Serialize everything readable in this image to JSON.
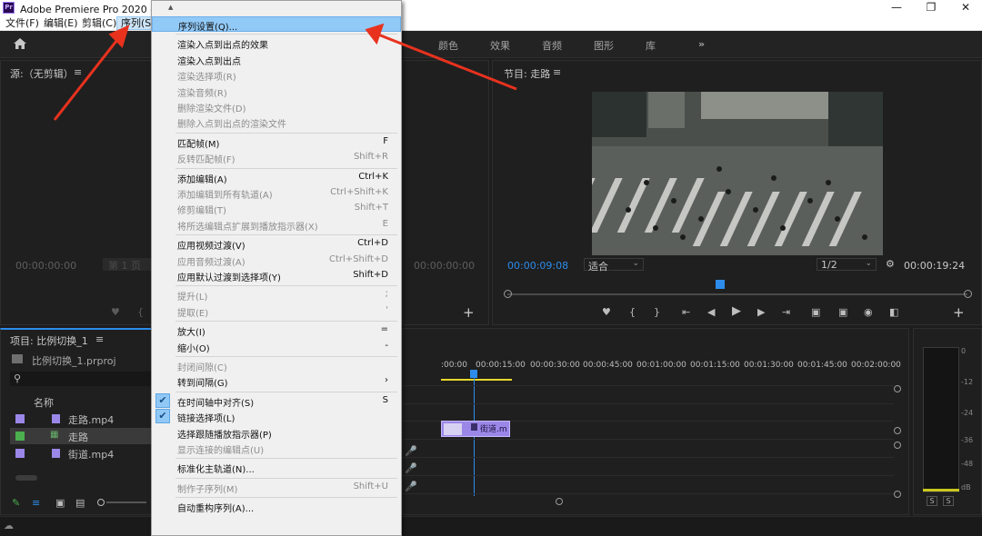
{
  "window": {
    "title": "Adobe Premiere Pro 2020 - E:\\用",
    "logo": "Pr",
    "min_icon": "minimize-icon",
    "max_icon": "restore-icon",
    "close_icon": "close-icon"
  },
  "menubar": [
    "文件(F)",
    "编辑(E)",
    "剪辑(C)",
    "序列(S)"
  ],
  "workspaces": [
    "颜色",
    "效果",
    "音频",
    "图形",
    "库"
  ],
  "workspaces_more": "»",
  "source_panel": {
    "title": "源:（无剪辑）",
    "timecode": "00:00:00:00",
    "page": "第 1 页",
    "timecode_right": "00:00:00:00",
    "add": "+"
  },
  "program_panel": {
    "title": "节目: 走路",
    "timecode": "00:00:09:08",
    "fit": "适合",
    "resolution": "1/2",
    "duration": "00:00:19:24",
    "add": "+"
  },
  "project_panel": {
    "title": "项目: 比例切换_1",
    "filename": "比例切换_1.prproj",
    "column_name": "名称",
    "items": [
      {
        "name": "走路.mp4",
        "color": "#9b87e8"
      },
      {
        "name": "走路",
        "color": "#4caf50"
      },
      {
        "name": "街道.mp4",
        "color": "#9b87e8"
      }
    ]
  },
  "timeline": {
    "ruler": [
      ":00:00",
      "00:00:15:00",
      "00:00:30:00",
      "00:00:45:00",
      "00:01:00:00",
      "00:01:15:00",
      "00:01:30:00",
      "00:01:45:00",
      "00:02:00:00"
    ],
    "clip_label": "街道.m"
  },
  "meter": {
    "scale": [
      "0",
      "-12",
      "-24",
      "-36",
      "-48",
      "dB"
    ],
    "solo": [
      "S",
      "S"
    ]
  },
  "menu": [
    {
      "type": "caret",
      "label": "▲"
    },
    {
      "label": "序列设置(Q)...",
      "shortcut": "",
      "disabled": false,
      "highlight": true
    },
    {
      "type": "sep"
    },
    {
      "label": "渲染入点到出点的效果",
      "shortcut": "",
      "disabled": false
    },
    {
      "label": "渲染入点到出点",
      "shortcut": "",
      "disabled": false
    },
    {
      "label": "渲染选择项(R)",
      "shortcut": "",
      "disabled": true
    },
    {
      "label": "渲染音频(R)",
      "shortcut": "",
      "disabled": true
    },
    {
      "label": "删除渲染文件(D)",
      "shortcut": "",
      "disabled": true
    },
    {
      "label": "删除入点到出点的渲染文件",
      "shortcut": "",
      "disabled": true
    },
    {
      "type": "sep"
    },
    {
      "label": "匹配帧(M)",
      "shortcut": "F",
      "disabled": false
    },
    {
      "label": "反转匹配帧(F)",
      "shortcut": "Shift+R",
      "disabled": true
    },
    {
      "type": "sep"
    },
    {
      "label": "添加编辑(A)",
      "shortcut": "Ctrl+K",
      "disabled": false
    },
    {
      "label": "添加编辑到所有轨道(A)",
      "shortcut": "Ctrl+Shift+K",
      "disabled": true
    },
    {
      "label": "修剪编辑(T)",
      "shortcut": "Shift+T",
      "disabled": true
    },
    {
      "label": "将所选编辑点扩展到播放指示器(X)",
      "shortcut": "E",
      "disabled": true
    },
    {
      "type": "sep"
    },
    {
      "label": "应用视频过渡(V)",
      "shortcut": "Ctrl+D",
      "disabled": false
    },
    {
      "label": "应用音频过渡(A)",
      "shortcut": "Ctrl+Shift+D",
      "disabled": true
    },
    {
      "label": "应用默认过渡到选择项(Y)",
      "shortcut": "Shift+D",
      "disabled": false
    },
    {
      "type": "sep"
    },
    {
      "label": "提升(L)",
      "shortcut": ";",
      "disabled": true
    },
    {
      "label": "提取(E)",
      "shortcut": "'",
      "disabled": true
    },
    {
      "type": "sep"
    },
    {
      "label": "放大(I)",
      "shortcut": "=",
      "disabled": false
    },
    {
      "label": "缩小(O)",
      "shortcut": "-",
      "disabled": false
    },
    {
      "type": "sep"
    },
    {
      "label": "封闭间隙(C)",
      "shortcut": "",
      "disabled": true
    },
    {
      "label": "转到间隔(G)",
      "shortcut": "›",
      "disabled": false
    },
    {
      "type": "sep"
    },
    {
      "label": "在时间轴中对齐(S)",
      "shortcut": "S",
      "disabled": false,
      "checked": true
    },
    {
      "label": "链接选择项(L)",
      "shortcut": "",
      "disabled": false,
      "checked": true
    },
    {
      "label": "选择跟随播放指示器(P)",
      "shortcut": "",
      "disabled": false
    },
    {
      "label": "显示连接的编辑点(U)",
      "shortcut": "",
      "disabled": true
    },
    {
      "type": "sep"
    },
    {
      "label": "标准化主轨道(N)...",
      "shortcut": "",
      "disabled": false
    },
    {
      "type": "sep"
    },
    {
      "label": "制作子序列(M)",
      "shortcut": "Shift+U",
      "disabled": true
    },
    {
      "type": "sep"
    },
    {
      "label": "自动重构序列(A)...",
      "shortcut": "",
      "disabled": false
    }
  ]
}
